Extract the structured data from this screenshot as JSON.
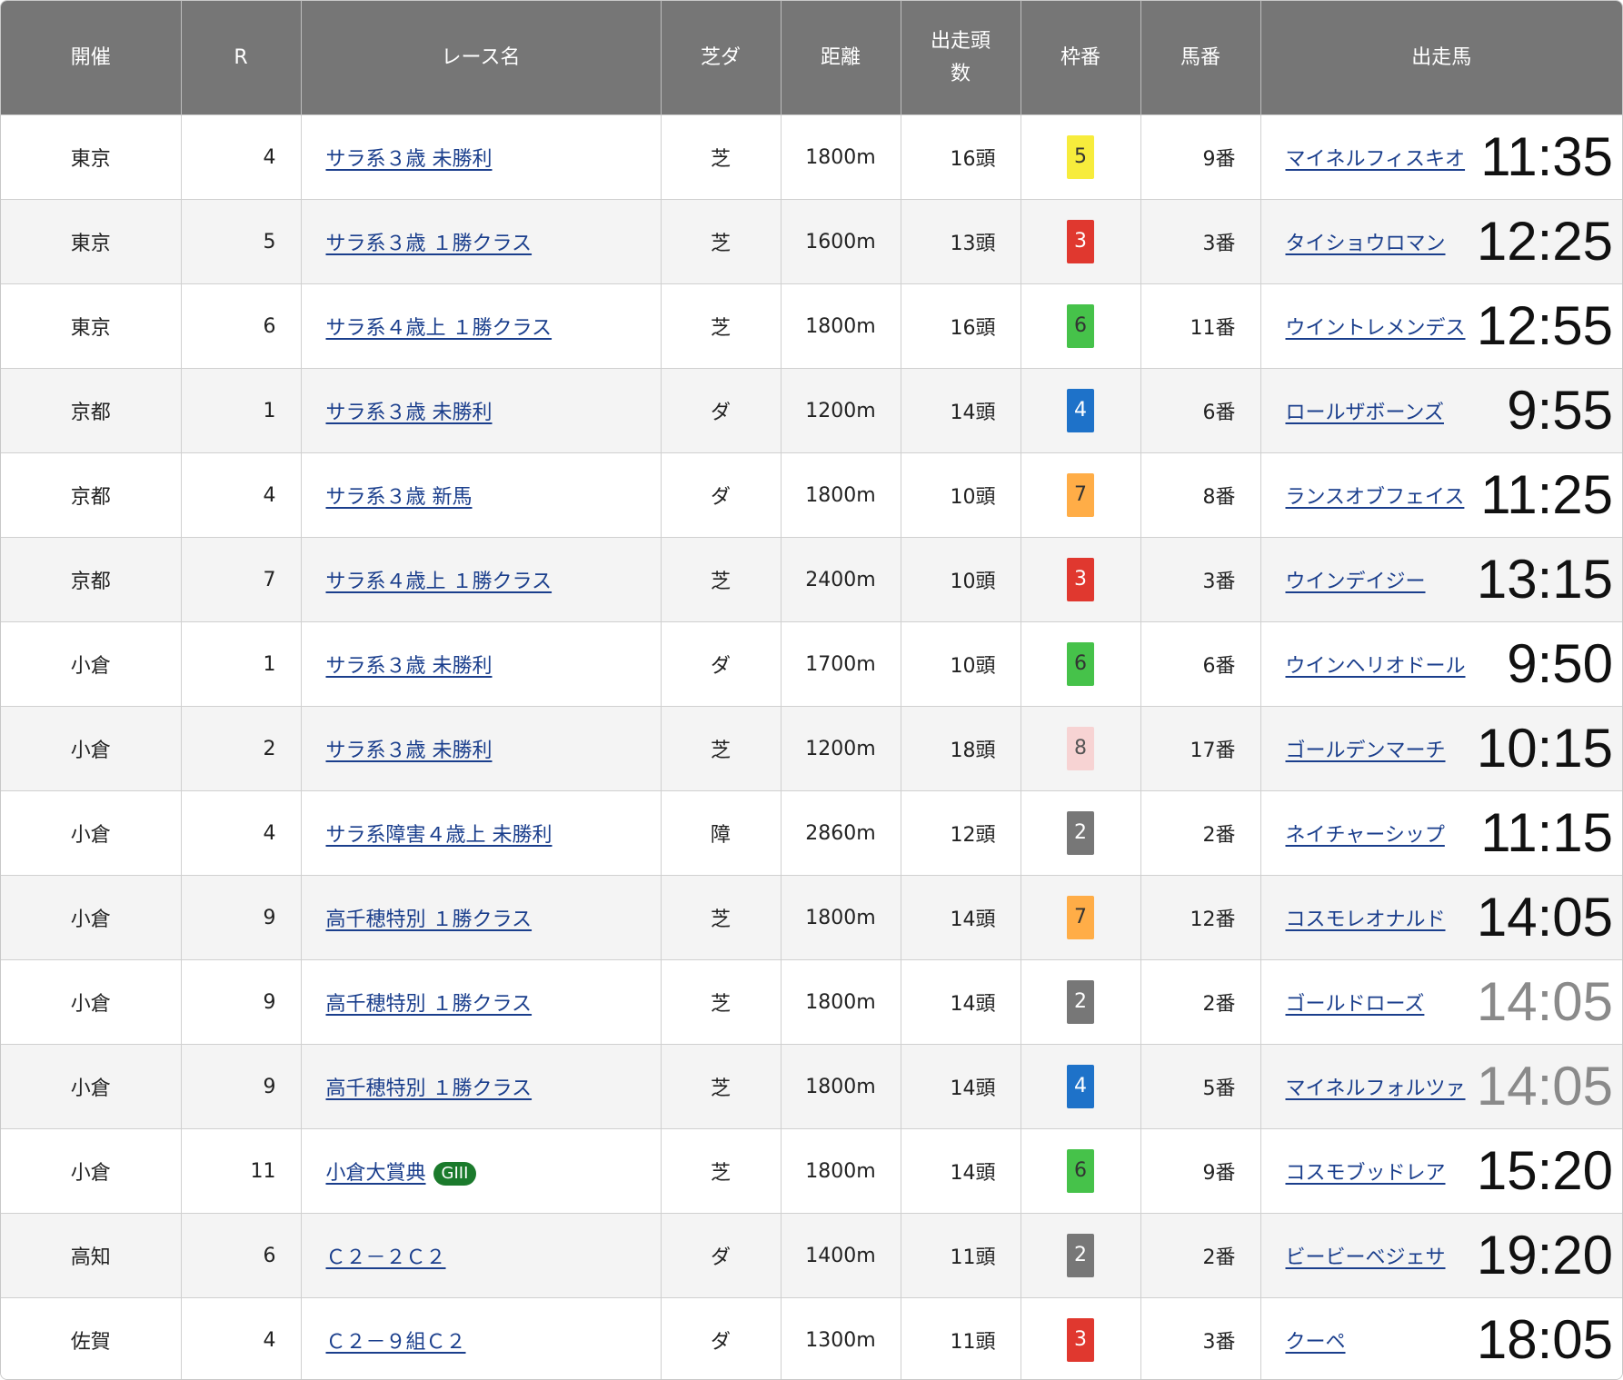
{
  "headers": {
    "venue": "開催",
    "race_no": "R",
    "race_name": "レース名",
    "surface": "芝ダ",
    "distance": "距離",
    "runners_1": "出走頭",
    "runners_2": "数",
    "gate": "枠番",
    "horse_no": "馬番",
    "horse": "出走馬"
  },
  "colors": {
    "header_bg": "#767676",
    "link": "#1a3e8c",
    "gate_1": "#ffffff",
    "gate_2": "#777777",
    "gate_3": "#e0382f",
    "gate_4": "#1e72c9",
    "gate_5": "#f7ec3c",
    "gate_6": "#46c24a",
    "gate_7": "#ffad47",
    "gate_8": "#f7d3d3",
    "grade_badge": "#1b7a2c"
  },
  "rows": [
    {
      "venue": "東京",
      "race_no": "4",
      "race_name": "サラ系３歳 未勝利",
      "grade": "",
      "surface": "芝",
      "distance": "1800m",
      "runners": "16頭",
      "gate": "5",
      "horse_no": "9番",
      "horse": "マイネルフィスキオ",
      "time": "11:35",
      "time_dim": false
    },
    {
      "venue": "東京",
      "race_no": "5",
      "race_name": "サラ系３歳 １勝クラス",
      "grade": "",
      "surface": "芝",
      "distance": "1600m",
      "runners": "13頭",
      "gate": "3",
      "horse_no": "3番",
      "horse": "タイショウロマン",
      "time": "12:25",
      "time_dim": false
    },
    {
      "venue": "東京",
      "race_no": "6",
      "race_name": "サラ系４歳上 １勝クラス",
      "grade": "",
      "surface": "芝",
      "distance": "1800m",
      "runners": "16頭",
      "gate": "6",
      "horse_no": "11番",
      "horse": "ウイントレメンデス",
      "time": "12:55",
      "time_dim": false
    },
    {
      "venue": "京都",
      "race_no": "1",
      "race_name": "サラ系３歳 未勝利",
      "grade": "",
      "surface": "ダ",
      "distance": "1200m",
      "runners": "14頭",
      "gate": "4",
      "horse_no": "6番",
      "horse": "ロールザボーンズ",
      "time": "9:55",
      "time_dim": false
    },
    {
      "venue": "京都",
      "race_no": "4",
      "race_name": "サラ系３歳 新馬",
      "grade": "",
      "surface": "ダ",
      "distance": "1800m",
      "runners": "10頭",
      "gate": "7",
      "horse_no": "8番",
      "horse": "ランスオブフェイス",
      "time": "11:25",
      "time_dim": false
    },
    {
      "venue": "京都",
      "race_no": "7",
      "race_name": "サラ系４歳上 １勝クラス",
      "grade": "",
      "surface": "芝",
      "distance": "2400m",
      "runners": "10頭",
      "gate": "3",
      "horse_no": "3番",
      "horse": "ウインデイジー",
      "time": "13:15",
      "time_dim": false
    },
    {
      "venue": "小倉",
      "race_no": "1",
      "race_name": "サラ系３歳 未勝利",
      "grade": "",
      "surface": "ダ",
      "distance": "1700m",
      "runners": "10頭",
      "gate": "6",
      "horse_no": "6番",
      "horse": "ウインヘリオドール",
      "time": "9:50",
      "time_dim": false
    },
    {
      "venue": "小倉",
      "race_no": "2",
      "race_name": "サラ系３歳 未勝利",
      "grade": "",
      "surface": "芝",
      "distance": "1200m",
      "runners": "18頭",
      "gate": "8",
      "horse_no": "17番",
      "horse": "ゴールデンマーチ",
      "time": "10:15",
      "time_dim": false
    },
    {
      "venue": "小倉",
      "race_no": "4",
      "race_name": "サラ系障害４歳上 未勝利",
      "grade": "",
      "surface": "障",
      "distance": "2860m",
      "runners": "12頭",
      "gate": "2",
      "horse_no": "2番",
      "horse": "ネイチャーシップ",
      "time": "11:15",
      "time_dim": false
    },
    {
      "venue": "小倉",
      "race_no": "9",
      "race_name": "高千穂特別 １勝クラス",
      "grade": "",
      "surface": "芝",
      "distance": "1800m",
      "runners": "14頭",
      "gate": "7",
      "horse_no": "12番",
      "horse": "コスモレオナルド",
      "time": "14:05",
      "time_dim": false
    },
    {
      "venue": "小倉",
      "race_no": "9",
      "race_name": "高千穂特別 １勝クラス",
      "grade": "",
      "surface": "芝",
      "distance": "1800m",
      "runners": "14頭",
      "gate": "2",
      "horse_no": "2番",
      "horse": "ゴールドローズ",
      "time": "14:05",
      "time_dim": true
    },
    {
      "venue": "小倉",
      "race_no": "9",
      "race_name": "高千穂特別 １勝クラス",
      "grade": "",
      "surface": "芝",
      "distance": "1800m",
      "runners": "14頭",
      "gate": "4",
      "horse_no": "5番",
      "horse": "マイネルフォルツァ",
      "time": "14:05",
      "time_dim": true
    },
    {
      "venue": "小倉",
      "race_no": "11",
      "race_name": "小倉大賞典",
      "grade": "GIII",
      "surface": "芝",
      "distance": "1800m",
      "runners": "14頭",
      "gate": "6",
      "horse_no": "9番",
      "horse": "コスモブッドレア",
      "time": "15:20",
      "time_dim": false
    },
    {
      "venue": "高知",
      "race_no": "6",
      "race_name": "Ｃ２－２Ｃ２",
      "grade": "",
      "surface": "ダ",
      "distance": "1400m",
      "runners": "11頭",
      "gate": "2",
      "horse_no": "2番",
      "horse": "ビービーベジェサ",
      "time": "19:20",
      "time_dim": false
    },
    {
      "venue": "佐賀",
      "race_no": "4",
      "race_name": "Ｃ２－９組Ｃ２",
      "grade": "",
      "surface": "ダ",
      "distance": "1300m",
      "runners": "11頭",
      "gate": "3",
      "horse_no": "3番",
      "horse": "クーペ",
      "time": "18:05",
      "time_dim": false
    }
  ]
}
